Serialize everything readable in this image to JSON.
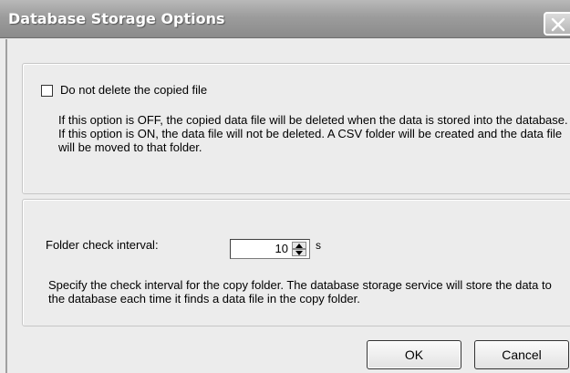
{
  "window": {
    "title": "Database Storage Options"
  },
  "copy_group": {
    "checkbox_label": "Do not delete the copied file",
    "checkbox_checked": false,
    "description": "If this option is OFF, the copied data file will be deleted when the data is stored into the database. If this option is ON, the data file will not be deleted. A CSV folder will be created and the data file will be moved to that folder."
  },
  "interval_group": {
    "label": "Folder check interval:",
    "value": "10",
    "unit": "s",
    "description": "Specify the check interval for the copy folder. The database storage service will store the data to the database each time it finds a data file in the copy folder."
  },
  "buttons": {
    "ok": "OK",
    "cancel": "Cancel"
  },
  "icons": {
    "close": "close-icon",
    "spin_up": "arrow-up-icon",
    "spin_down": "arrow-down-icon"
  }
}
